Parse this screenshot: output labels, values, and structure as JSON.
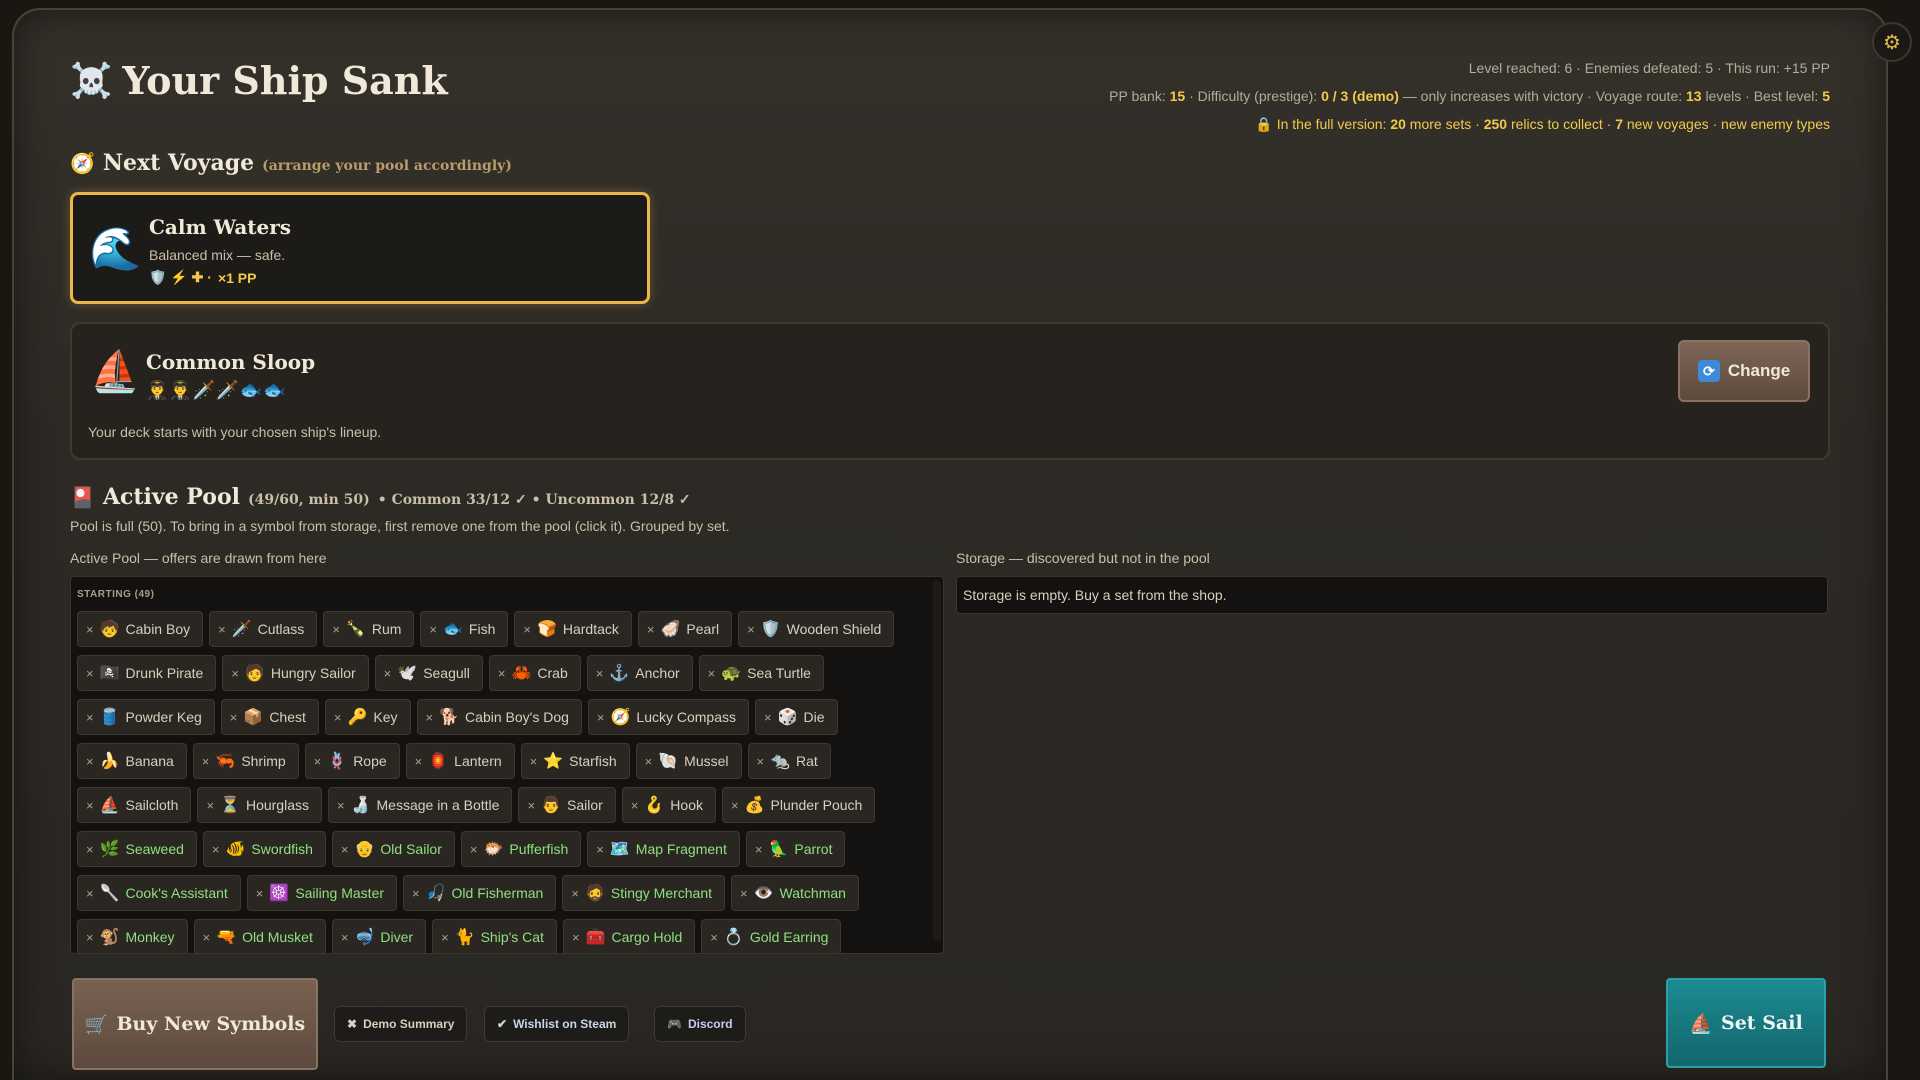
{
  "header": {
    "skull_icon": "☠️",
    "title": "Your Ship Sank",
    "settings_icon": "⚙"
  },
  "stats": {
    "line1": "Level reached: 6 · Enemies defeated: 5 · This run: +15 PP",
    "pp_bank_label": "PP bank:",
    "pp_bank_value": "15",
    "difficulty_label": "· Difficulty (prestige):",
    "difficulty_value": "0 / 3 (demo)",
    "difficulty_note": "— only increases with victory · Voyage route:",
    "route_value": "13",
    "route_unit": "levels · Best level:",
    "best_level": "5",
    "full_version_prefix": "In the full version:",
    "sets_count": "20",
    "sets_text": "more sets ·",
    "relics_count": "250",
    "relics_text": "relics to collect ·",
    "voyages_count": "7",
    "voyages_text": "new voyages · new enemy types"
  },
  "next_voyage": {
    "heading": "Next Voyage",
    "sub": "(arrange your pool accordingly)",
    "name": "Calm Waters",
    "desc": "Balanced mix — safe.",
    "mods_icons": "🛡️ ⚡ ✚ ·",
    "mods_text": "×1 PP"
  },
  "ship": {
    "name": "Common Sloop",
    "lineup": "👨‍✈️👨‍✈️🗡️🗡️🐟🐟",
    "note": "Your deck starts with your chosen ship's lineup.",
    "change_label": "Change"
  },
  "active_pool": {
    "heading": "Active Pool",
    "counts": "(49/60, min 50)",
    "rarity": "• Common 33/12 ✓ • Uncommon 12/8 ✓",
    "hint": "Pool is full (50). To bring in a symbol from storage, first remove one from the pool (click it). Grouped by set.",
    "col_label": "Active Pool — offers are drawn from here",
    "group_label": "STARTING (49)",
    "chips": [
      {
        "label": "Cabin Boy",
        "icon": "🧒"
      },
      {
        "label": "Cutlass",
        "icon": "🗡️"
      },
      {
        "label": "Rum",
        "icon": "🍾"
      },
      {
        "label": "Fish",
        "icon": "🐟"
      },
      {
        "label": "Hardtack",
        "icon": "🍞"
      },
      {
        "label": "Pearl",
        "icon": "🦪"
      },
      {
        "label": "Wooden Shield",
        "icon": "🛡️"
      },
      {
        "label": "Drunk Pirate",
        "icon": "🏴‍☠️"
      },
      {
        "label": "Hungry Sailor",
        "icon": "🧑"
      },
      {
        "label": "Seagull",
        "icon": "🕊️"
      },
      {
        "label": "Crab",
        "icon": "🦀"
      },
      {
        "label": "Anchor",
        "icon": "⚓"
      },
      {
        "label": "Sea Turtle",
        "icon": "🐢"
      },
      {
        "label": "Powder Keg",
        "icon": "🛢️"
      },
      {
        "label": "Chest",
        "icon": "📦"
      },
      {
        "label": "Key",
        "icon": "🔑"
      },
      {
        "label": "Cabin Boy's Dog",
        "icon": "🐕"
      },
      {
        "label": "Lucky Compass",
        "icon": "🧭"
      },
      {
        "label": "Die",
        "icon": "🎲"
      },
      {
        "label": "Banana",
        "icon": "🍌"
      },
      {
        "label": "Shrimp",
        "icon": "🦐"
      },
      {
        "label": "Rope",
        "icon": "🪢"
      },
      {
        "label": "Lantern",
        "icon": "🏮"
      },
      {
        "label": "Starfish",
        "icon": "⭐"
      },
      {
        "label": "Mussel",
        "icon": "🐚"
      },
      {
        "label": "Rat",
        "icon": "🐀"
      },
      {
        "label": "Sailcloth",
        "icon": "⛵"
      },
      {
        "label": "Hourglass",
        "icon": "⏳"
      },
      {
        "label": "Message in a Bottle",
        "icon": "🍶"
      },
      {
        "label": "Sailor",
        "icon": "👨"
      },
      {
        "label": "Hook",
        "icon": "🪝"
      },
      {
        "label": "Plunder Pouch",
        "icon": "💰"
      },
      {
        "label": "Seaweed",
        "icon": "🌿",
        "green": true
      },
      {
        "label": "Swordfish",
        "icon": "🐠",
        "green": true
      },
      {
        "label": "Old Sailor",
        "icon": "👴",
        "green": true
      },
      {
        "label": "Pufferfish",
        "icon": "🐡",
        "green": true
      },
      {
        "label": "Map Fragment",
        "icon": "🗺️",
        "green": true
      },
      {
        "label": "Parrot",
        "icon": "🦜",
        "green": true
      },
      {
        "label": "Cook's Assistant",
        "icon": "🥄",
        "green": true
      },
      {
        "label": "Sailing Master",
        "icon": "☸️",
        "green": true
      },
      {
        "label": "Old Fisherman",
        "icon": "🎣",
        "green": true
      },
      {
        "label": "Stingy Merchant",
        "icon": "🧔",
        "green": true
      },
      {
        "label": "Watchman",
        "icon": "👁️",
        "green": true
      },
      {
        "label": "Monkey",
        "icon": "🐒",
        "green": true
      },
      {
        "label": "Old Musket",
        "icon": "🔫",
        "green": true
      },
      {
        "label": "Diver",
        "icon": "🤿",
        "green": true
      },
      {
        "label": "Ship's Cat",
        "icon": "🐈",
        "green": true
      },
      {
        "label": "Cargo Hold",
        "icon": "🧰",
        "green": true
      },
      {
        "label": "Gold Earring",
        "icon": "💍",
        "green": true
      }
    ]
  },
  "storage": {
    "col_label": "Storage — discovered but not in the pool",
    "empty_text": "Storage is empty. Buy a set from the shop."
  },
  "footer": {
    "buy_label": "Buy New Symbols",
    "demo_label": "Demo Summary",
    "steam_label": "Wishlist on Steam",
    "discord_label": "Discord",
    "sail_label": "Set Sail"
  },
  "colors": {
    "accent_gold": "#f2c94c",
    "uncommon_green": "#8fe07f",
    "sail_teal": "#1d8a92"
  }
}
